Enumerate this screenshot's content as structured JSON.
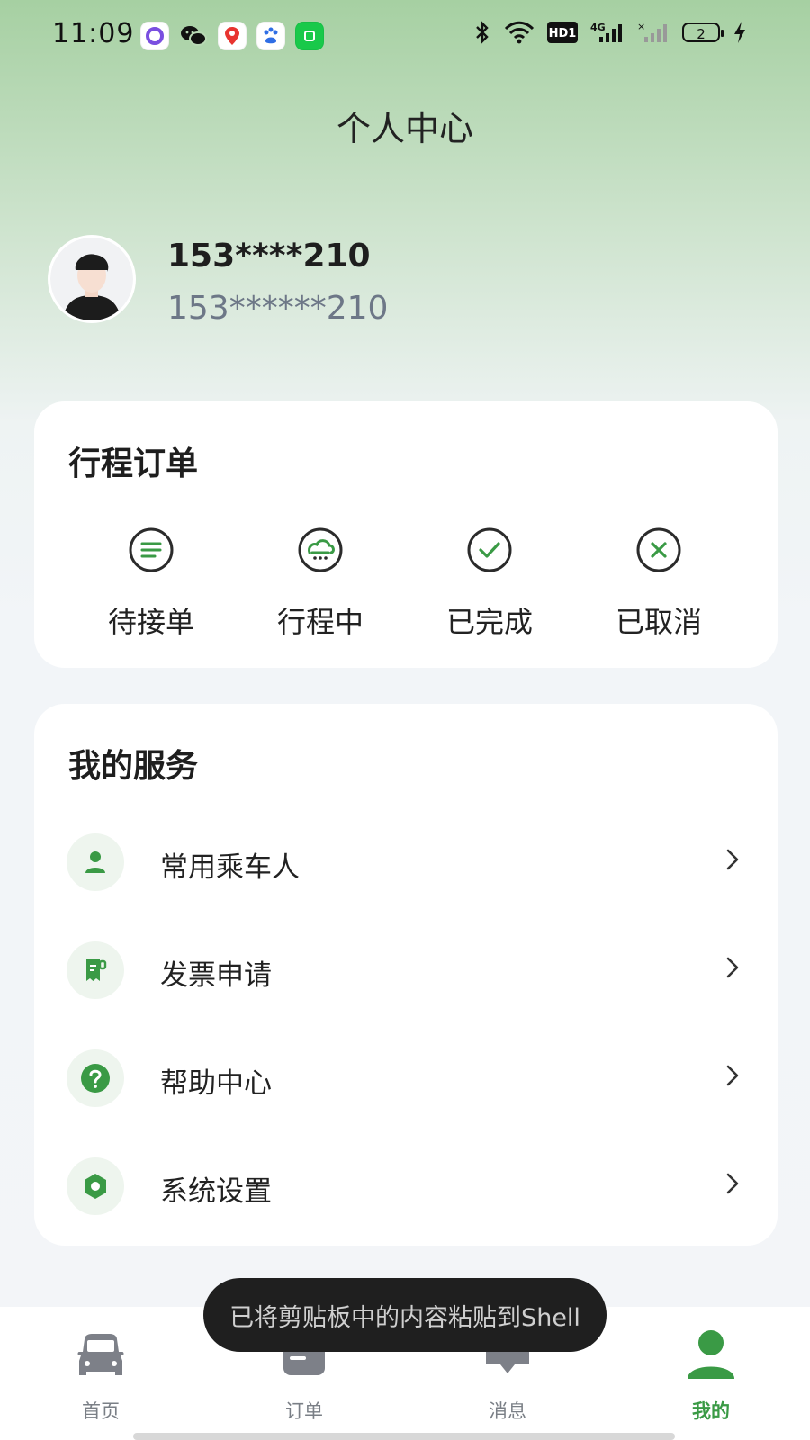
{
  "status_bar": {
    "time": "11:09",
    "app_icons": [
      "circle-app-icon",
      "wechat-icon",
      "map-pin-app-icon",
      "baidu-app-icon",
      "green-app-icon"
    ],
    "network": "4G",
    "hd": "HD1",
    "battery": "2"
  },
  "header": {
    "title": "个人中心"
  },
  "profile": {
    "name": "153****210",
    "phone": "153******210"
  },
  "orders": {
    "title": "行程订单",
    "items": [
      {
        "label": "待接单",
        "icon": "list-icon"
      },
      {
        "label": "行程中",
        "icon": "car-cloud-icon"
      },
      {
        "label": "已完成",
        "icon": "check-icon"
      },
      {
        "label": "已取消",
        "icon": "cancel-icon"
      }
    ]
  },
  "services": {
    "title": "我的服务",
    "items": [
      {
        "label": "常用乘车人",
        "icon": "person-icon"
      },
      {
        "label": "发票申请",
        "icon": "invoice-icon"
      },
      {
        "label": "帮助中心",
        "icon": "help-icon"
      },
      {
        "label": "系统设置",
        "icon": "settings-icon"
      }
    ]
  },
  "tabbar": {
    "items": [
      {
        "label": "首页",
        "icon": "car-icon",
        "active": false
      },
      {
        "label": "订单",
        "icon": "order-icon",
        "active": false
      },
      {
        "label": "消息",
        "icon": "message-icon",
        "active": false
      },
      {
        "label": "我的",
        "icon": "profile-icon",
        "active": true
      }
    ]
  },
  "toast": {
    "text": "已将剪贴板中的内容粘贴到Shell"
  },
  "colors": {
    "accent": "#3a9a45",
    "icon_bg": "#eef5ee",
    "tab_inactive": "#7a7f86"
  }
}
